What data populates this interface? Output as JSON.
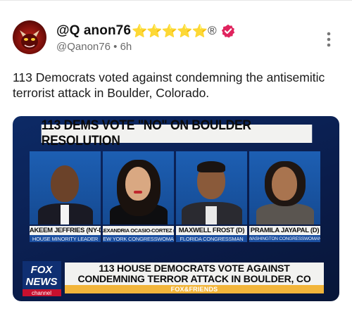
{
  "post": {
    "display_name": "@Q anon76",
    "stars": "⭐⭐⭐⭐⭐",
    "reg_mark": "®",
    "handle": "@Qanon76",
    "separator": "•",
    "time": "6h",
    "text": "113 Democrats voted against condemning the antisemitic terrorist attack in Boulder, Colorado."
  },
  "media": {
    "banner": "113 DEMS VOTE \"NO\" ON BOULDER RESOLUTION",
    "people": [
      {
        "name": "HAKEEM JEFFRIES (NY-D)",
        "title": "HOUSE MINORITY LEADER"
      },
      {
        "name": "ALEXANDRIA OCASIO-CORTEZ (D)",
        "title": "NEW YORK CONGRESSWOMAN"
      },
      {
        "name": "MAXWELL FROST (D)",
        "title": "FLORIDA CONGRESSMAN"
      },
      {
        "name": "PRAMILA JAYAPAL (D)",
        "title": "WASHINGTON CONGRESSWOMAN"
      }
    ],
    "logo": {
      "line1": "FOX",
      "line2": "NEWS",
      "line3": "channel"
    },
    "lower_third": {
      "line1": "113 HOUSE DEMOCRATS VOTE AGAINST",
      "line2": "CONDEMNING TERROR ATTACK IN BOULDER, CO"
    },
    "show": "FOX&FRIENDS"
  },
  "colors": {
    "star": "#f5b400",
    "verified": "#e0245e",
    "accent_bar": "#f2b53b",
    "bg_navy": "#0a1c4a"
  }
}
